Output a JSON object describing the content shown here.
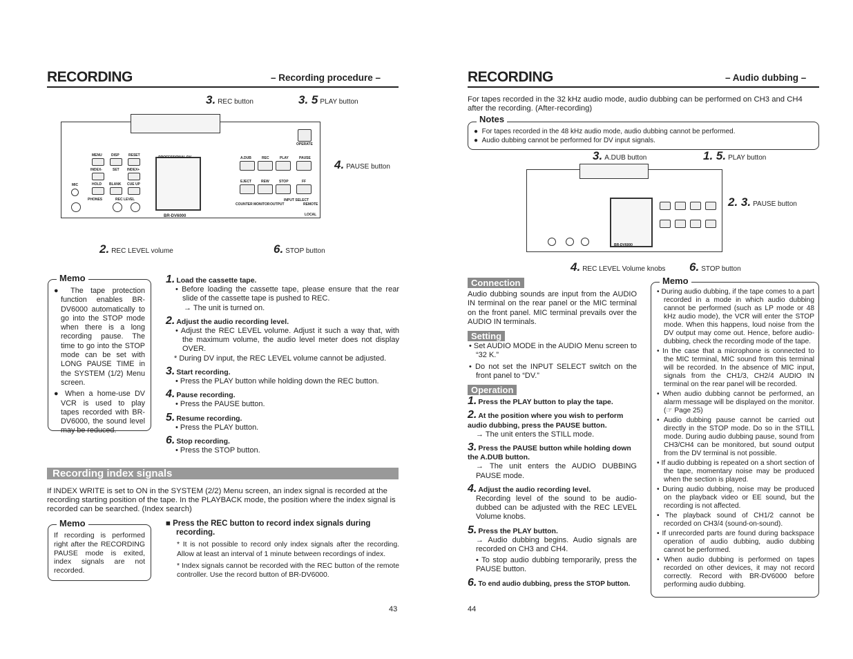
{
  "left": {
    "title": "RECORDING",
    "subtitle": "– Recording procedure –",
    "callouts": [
      {
        "num": "3.",
        "text": "REC button"
      },
      {
        "num": "3. 5",
        "text": "PLAY button"
      },
      {
        "num": "4.",
        "text": "PAUSE button"
      },
      {
        "num": "2.",
        "text": "REC LEVEL volume"
      },
      {
        "num": "6.",
        "text": "STOP button"
      }
    ],
    "device": {
      "model": "BR-DV6000",
      "brand": "PROFESSIONAL DV",
      "labels": [
        "MENU",
        "DISP",
        "RESET",
        "INDEX-",
        "SET",
        "INDEX+",
        "HOLD",
        "BLANK",
        "CUE UP",
        "MIC",
        "PHONES",
        "REC LEVEL",
        "A.DUB",
        "REC",
        "PLAY",
        "PAUSE",
        "EJECT",
        "REW",
        "STOP",
        "FF",
        "OPERATE",
        "COUNTER",
        "MONITOR",
        "OUTPUT",
        "INPUT SELECT",
        "REMOTE",
        "LOCAL"
      ]
    },
    "memo": {
      "title": "Memo",
      "items": [
        "The tape protection function enables BR-DV6000 automatically to go into the STOP mode when there is a long recording pause. The time to go into the STOP mode can be set with LONG PAUSE TIME in the SYSTEM (1/2) Menu screen.",
        "When a home-use DV VCR is used to play tapes recorded with BR-DV6000, the sound level may be reduced."
      ]
    },
    "steps": [
      {
        "num": "1.",
        "title": "Load the cassette tape.",
        "lines": [
          "• Before loading the cassette tape, please ensure that the rear slide of the cassette tape is pushed to REC.",
          "→ The unit is turned on."
        ]
      },
      {
        "num": "2.",
        "title": "Adjust the audio recording level.",
        "lines": [
          "• Adjust the REC LEVEL volume. Adjust it such a way that, with the maximum volume, the audio level meter does not display OVER.",
          "* During DV input, the REC LEVEL volume cannot be adjusted."
        ]
      },
      {
        "num": "3.",
        "title": "Start recording.",
        "lines": [
          "• Press the PLAY button while holding down the REC button."
        ]
      },
      {
        "num": "4.",
        "title": "Pause recording.",
        "lines": [
          "• Press the PAUSE button."
        ]
      },
      {
        "num": "5.",
        "title": "Resume recording.",
        "lines": [
          "• Press the PLAY button."
        ]
      },
      {
        "num": "6.",
        "title": "Stop recording.",
        "lines": [
          "• Press the STOP button."
        ]
      }
    ],
    "index": {
      "heading": "Recording index signals",
      "intro": "If INDEX WRITE is set to ON in the SYSTEM (2/2) Menu screen, an index signal is recorded at the recording starting position of the tape. In the PLAYBACK mode, the position where the index signal is recorded can be searched. (Index search)",
      "memo_title": "Memo",
      "memo_text": "If recording is performed right after the RECORDING PAUSE mode is exited, index signals are not recorded.",
      "instruction": "■ Press the REC button to record index signals during recording.",
      "notes": [
        "* It is not possible to record only index signals after the recording. Allow at least an interval of 1 minute between recordings of index.",
        "* Index signals cannot be recorded with the REC button of the remote controller. Use the record button of BR-DV6000."
      ]
    },
    "page_num": "43"
  },
  "right": {
    "title": "RECORDING",
    "subtitle": "– Audio dubbing –",
    "intro": "For tapes recorded in the 32 kHz audio mode, audio dubbing can be performed on CH3 and CH4 after the recording. (After-recording)",
    "notes": {
      "title": "Notes",
      "items": [
        "For tapes recorded in the 48 kHz audio mode, audio dubbing cannot be performed.",
        "Audio dubbing cannot be performed for DV input signals."
      ]
    },
    "callouts": [
      {
        "num": "3.",
        "text": "A.DUB button"
      },
      {
        "num": "1. 5.",
        "text": "PLAY button"
      },
      {
        "num": "2. 3.",
        "text": "PAUSE button"
      },
      {
        "num": "4.",
        "text": "REC LEVEL Volume knobs"
      },
      {
        "num": "6.",
        "text": "STOP button"
      }
    ],
    "connection": {
      "tag": "Connection",
      "text": "Audio dubbing sounds are input from the AUDIO IN terminal on the rear panel or the MIC terminal on the front panel. MIC terminal prevails over the AUDIO IN terminals."
    },
    "setting": {
      "tag": "Setting",
      "items": [
        "• Set AUDIO MODE in the AUDIO Menu screen to “32 K.”",
        "• Do not set the INPUT SELECT switch on the front panel to “DV.”"
      ]
    },
    "operation": {
      "tag": "Operation",
      "steps": [
        {
          "num": "1.",
          "title": "Press the PLAY button to play the tape.",
          "lines": []
        },
        {
          "num": "2.",
          "title": "At the position where you wish to perform audio dubbing, press the PAUSE button.",
          "lines": [
            "→ The unit enters the STILL mode."
          ]
        },
        {
          "num": "3.",
          "title": "Press the PAUSE button while holding down the A.DUB button.",
          "lines": [
            "→ The unit enters the AUDIO DUBBING PAUSE mode."
          ]
        },
        {
          "num": "4.",
          "title": "Adjust the audio recording level.",
          "lines": [
            "Recording level of the sound to be audio-dubbed can be adjusted with the REC LEVEL Volume knobs."
          ]
        },
        {
          "num": "5.",
          "title": "Press the PLAY button.",
          "lines": [
            "→ Audio dubbing begins. Audio signals are recorded on CH3 and CH4.",
            "• To stop audio dubbing temporarily, press the PAUSE button."
          ]
        },
        {
          "num": "6.",
          "title": "To end audio dubbing, press the STOP button.",
          "lines": []
        }
      ]
    },
    "memo": {
      "title": "Memo",
      "items": [
        "During audio dubbing, if the tape comes to a part recorded in a mode in which audio dubbing cannot be performed (such as LP mode or 48 kHz audio mode), the VCR will enter the STOP mode. When this happens, loud noise from the DV output may come out. Hence, before audio-dubbing, check the recording mode of the tape.",
        "In the case that a microphone is connected to the MIC terminal, MIC sound from this terminal will be recorded. In the absence of MIC input, signals from the CH1/3, CH2/4 AUDIO IN terminal on the rear panel will be recorded.",
        "When audio dubbing cannot be performed, an alarm message will be displayed on the monitor. (☞ Page 25)",
        "Audio dubbing pause cannot be carried out directly in the STOP mode. Do so in the STILL mode. During audio dubbing pause, sound from CH3/CH4 can be monitored, but sound output from the DV terminal is not possible.",
        "If audio dubbing is repeated on a short section of the tape, momentary noise may be produced when the section is played.",
        "During audio dubbing, noise may be produced on the playback video or EE sound, but the recording is not affected.",
        "The playback sound of CH1/2 cannot be recorded on CH3/4 (sound-on-sound).",
        "If unrecorded parts are found during backspace operation of audio dubbing, audio dubbing cannot be performed.",
        "When audio dubbing is performed on tapes recorded on other devices, it may not record correctly. Record with BR-DV6000 before performing audio dubbing."
      ]
    },
    "page_num": "44"
  }
}
